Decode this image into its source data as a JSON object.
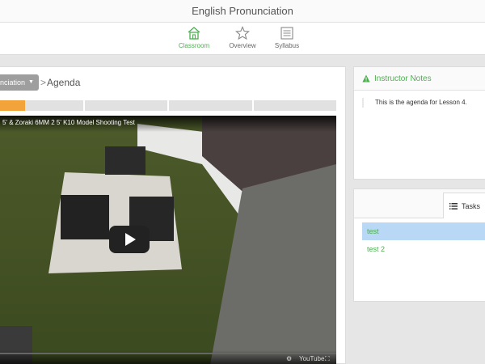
{
  "app": {
    "title": "English Pronunciation"
  },
  "nav": [
    {
      "id": "classroom",
      "label": "Classroom",
      "icon": "home-icon",
      "active": true
    },
    {
      "id": "overview",
      "label": "Overview",
      "icon": "star-icon",
      "active": false
    },
    {
      "id": "syllabus",
      "label": "Syllabus",
      "icon": "syllabus-icon",
      "active": false
    }
  ],
  "breadcrumb": {
    "dropdown_label": "nciation",
    "separator": ">",
    "page": "Agenda"
  },
  "progress": {
    "segments": 4,
    "filled_fraction_of_first": 0.3
  },
  "video": {
    "title": "5' & Zoraki 6MM 2 5' K10 Model Shooting Test",
    "controls": {
      "brand": "YouTube"
    }
  },
  "instructor_notes": {
    "title": "Instructor Notes",
    "body": "This is the agenda for Lesson 4."
  },
  "tasks": {
    "tab_label": "Tasks",
    "items": [
      {
        "label": "test",
        "selected": true
      },
      {
        "label": "test 2",
        "selected": false
      }
    ]
  },
  "colors": {
    "accent": "#4caf50",
    "progress": "#f2a33a",
    "selected": "#b9d8f5"
  }
}
